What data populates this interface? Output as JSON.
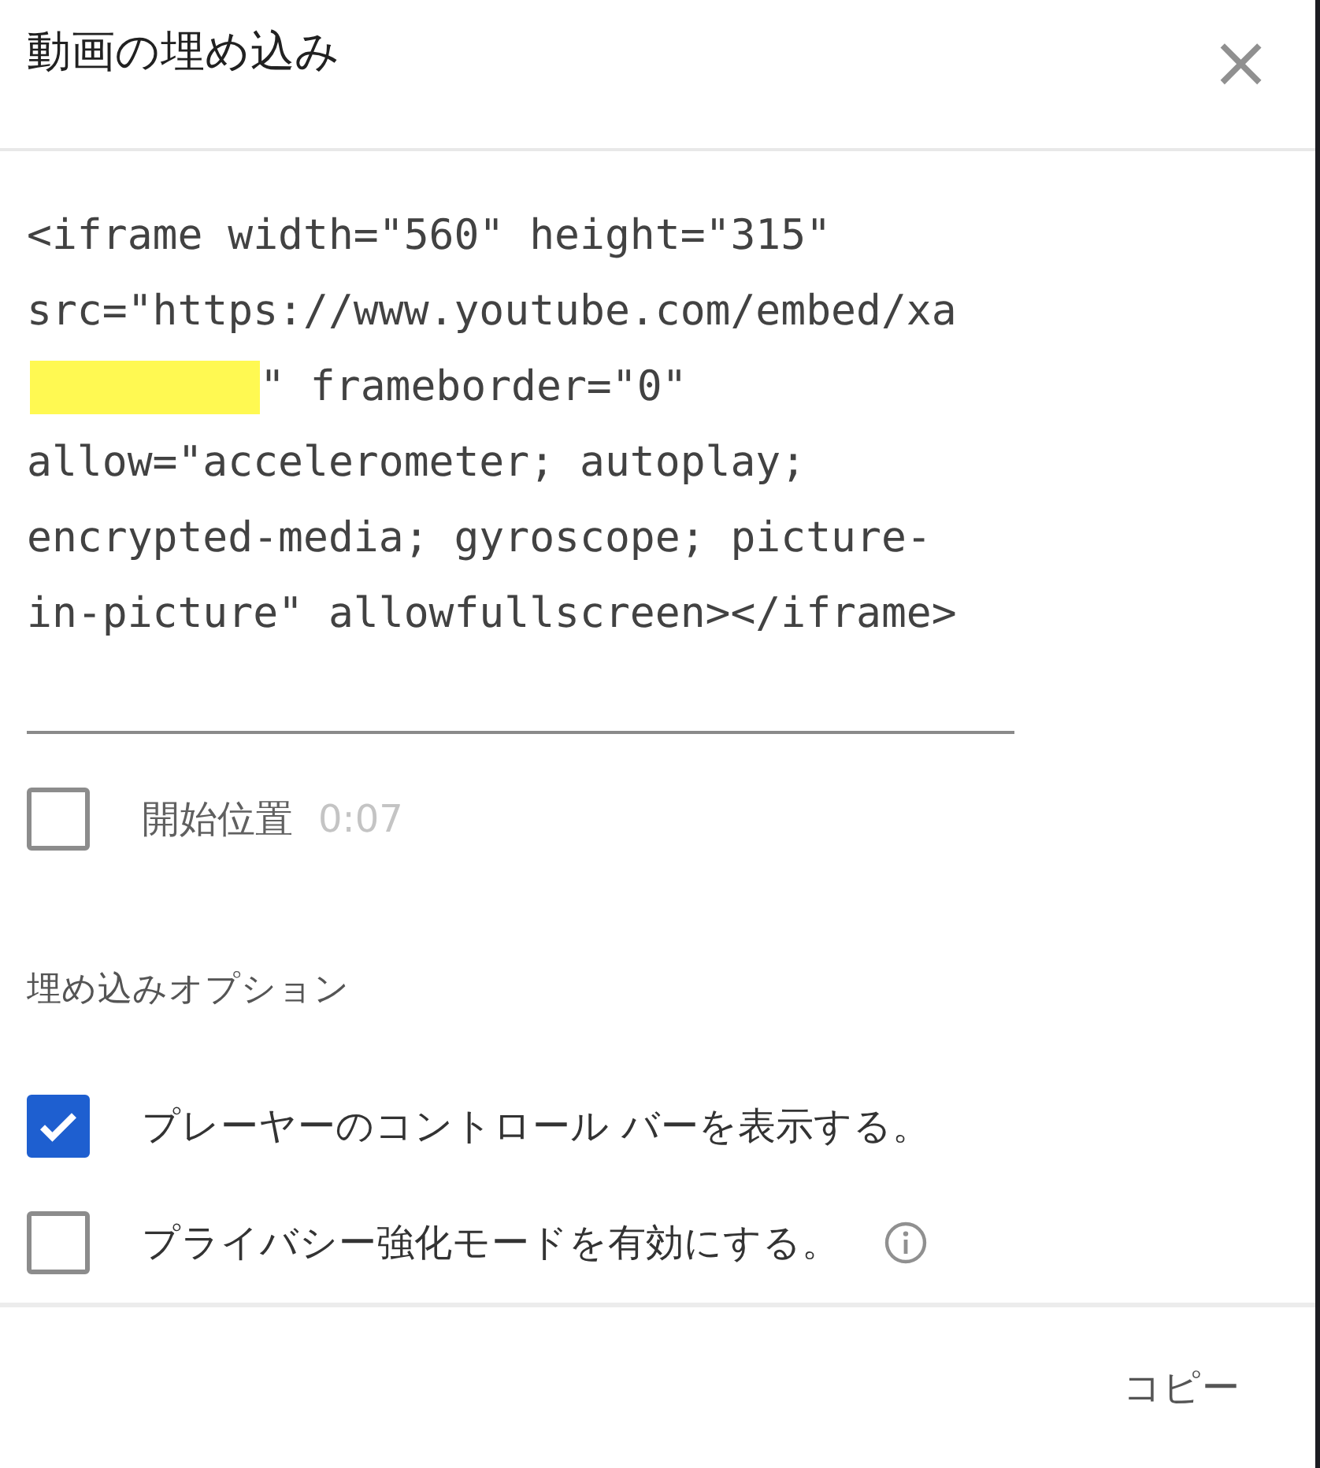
{
  "dialog": {
    "title": "動画の埋め込み",
    "close": "×"
  },
  "code": {
    "lines": [
      {
        "text": "<iframe width=\"560\" height=\"315\"",
        "redacted_before": false
      },
      {
        "text": "src=\"https://www.youtube.com/embed/xa",
        "redacted_before": false
      },
      {
        "text": "\" frameborder=\"0\"",
        "redacted_before": true
      },
      {
        "text": "allow=\"accelerometer; autoplay;",
        "redacted_before": false
      },
      {
        "text": "encrypted-media; gyroscope; picture-",
        "redacted_before": false
      },
      {
        "text": "in-picture\" allowfullscreen></iframe>",
        "redacted_before": false
      }
    ]
  },
  "start": {
    "label": "開始位置",
    "time": "0:07",
    "checked": false
  },
  "options_heading": "埋め込みオプション",
  "options": [
    {
      "label": "プレーヤーのコントロール バーを表示する。",
      "checked": true,
      "info": false
    },
    {
      "label": "プライバシー強化モードを有効にする。",
      "checked": false,
      "info": true
    }
  ],
  "buttons": [
    "コピー"
  ]
}
